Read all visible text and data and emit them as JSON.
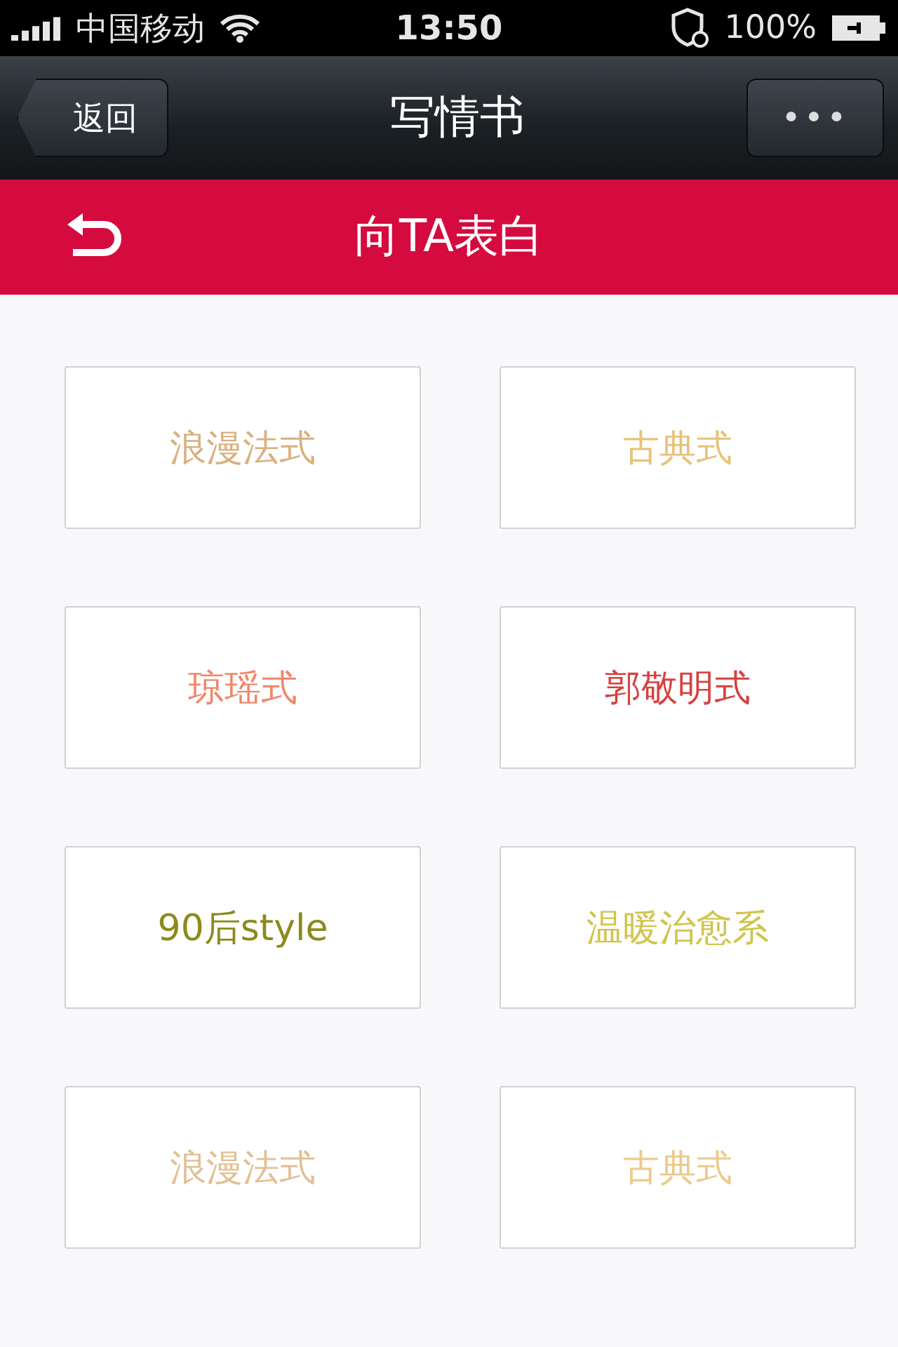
{
  "status_bar": {
    "carrier": "中国移动",
    "time": "13:50",
    "battery": "100%"
  },
  "nav_bar": {
    "back": "返回",
    "title": "写情书",
    "more": "•••"
  },
  "sub_header": {
    "title": "向TA表白"
  },
  "styles": [
    {
      "label": "浪漫法式",
      "color": "#d9b07f"
    },
    {
      "label": "古典式",
      "color": "#e8c27a"
    },
    {
      "label": "琼瑶式",
      "color": "#f0866a"
    },
    {
      "label": "郭敬明式",
      "color": "#d6403f"
    },
    {
      "label": "90后style",
      "color": "#8c8a1c"
    },
    {
      "label": "温暖治愈系",
      "color": "#d0c44c"
    },
    {
      "label": "浪漫法式",
      "color": "#e2c095"
    },
    {
      "label": "古典式",
      "color": "#ecca8c"
    }
  ]
}
